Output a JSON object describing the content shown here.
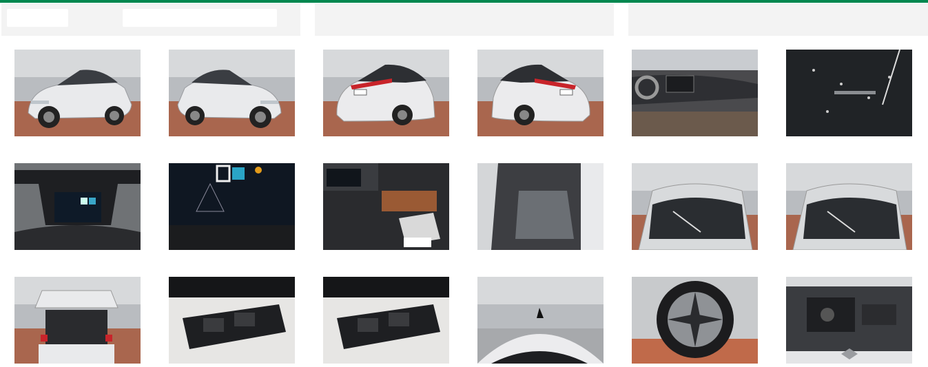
{
  "colors": {
    "accent": "#00874f",
    "panel": "#f3f3f3"
  },
  "header": {
    "panels": [
      {
        "name": "filter-panel-left"
      },
      {
        "name": "filter-panel-center"
      },
      {
        "name": "filter-panel-right"
      }
    ]
  },
  "gallery": {
    "columns": 6,
    "rows": 3,
    "photos": [
      {
        "subject": "car-front-three-quarter"
      },
      {
        "subject": "car-front-three-quarter"
      },
      {
        "subject": "car-rear-three-quarter"
      },
      {
        "subject": "car-rear-three-quarter"
      },
      {
        "subject": "interior-dashboard"
      },
      {
        "subject": "glass-roof-closeup"
      },
      {
        "subject": "instrument-cluster"
      },
      {
        "subject": "digital-display-closeup"
      },
      {
        "subject": "center-console-documents"
      },
      {
        "subject": "rear-seats"
      },
      {
        "subject": "windshield-roof"
      },
      {
        "subject": "windshield-roof"
      },
      {
        "subject": "open-trunk"
      },
      {
        "subject": "underbody-component"
      },
      {
        "subject": "underbody-component"
      },
      {
        "subject": "roof-antenna"
      },
      {
        "subject": "wheel-rim"
      },
      {
        "subject": "engine-bay"
      }
    ]
  }
}
